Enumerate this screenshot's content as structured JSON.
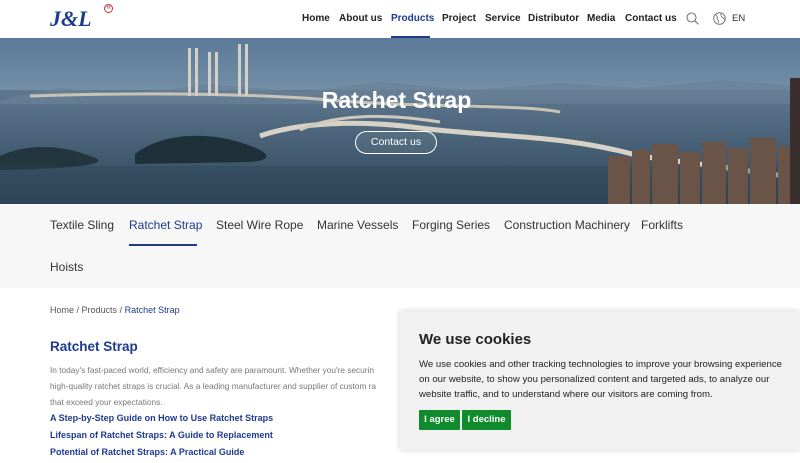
{
  "header": {
    "logo_text": "J&L",
    "logo_registered": "R",
    "nav": [
      {
        "label": "Home"
      },
      {
        "label": "About us"
      },
      {
        "label": "Products"
      },
      {
        "label": "Project"
      },
      {
        "label": "Service"
      },
      {
        "label": "Distributor"
      },
      {
        "label": "Media"
      },
      {
        "label": "Contact us"
      }
    ],
    "active_nav": "Products",
    "search_icon": "search-icon",
    "globe_icon": "globe-icon",
    "language": "EN"
  },
  "hero": {
    "title": "Ratchet Strap",
    "button_label": "Contact us"
  },
  "categories": {
    "items": [
      {
        "label": "Textile Sling"
      },
      {
        "label": "Ratchet Strap"
      },
      {
        "label": "Steel Wire Rope"
      },
      {
        "label": "Marine Vessels"
      },
      {
        "label": "Forging Series"
      },
      {
        "label": "Construction Machinery"
      },
      {
        "label": "Forklifts"
      },
      {
        "label": "Hoists"
      }
    ],
    "active": "Ratchet Strap"
  },
  "breadcrumb": {
    "home": "Home",
    "sep1": " / ",
    "products": "Products",
    "sep2": " / ",
    "current": "Ratchet Strap"
  },
  "content": {
    "title": "Ratchet Strap",
    "intro_lines": [
      "In today's fast-paced world, efficiency and safety are paramount. Whether you're securin",
      "high-quality ratchet straps is crucial. As a leading manufacturer and supplier of custom ra",
      "that exceed your expectations."
    ],
    "links": [
      "A Step-by-Step Guide on How to Use Ratchet Straps",
      "Lifespan of Ratchet Straps: A Guide to Replacement",
      "Potential of Ratchet Straps: A Practical Guide"
    ]
  },
  "cookie": {
    "title": "We use cookies",
    "text": "We use cookies and other tracking technologies to improve your browsing experience on our website, to show you personalized content and targeted ads, to analyze our website traffic, and to understand where our visitors are coming from.",
    "agree_label": "I agree",
    "decline_label": "I decline"
  },
  "colors": {
    "brand": "#1d3a8f",
    "accept_green": "#0f8a2d",
    "logo_red": "#d8262e"
  }
}
